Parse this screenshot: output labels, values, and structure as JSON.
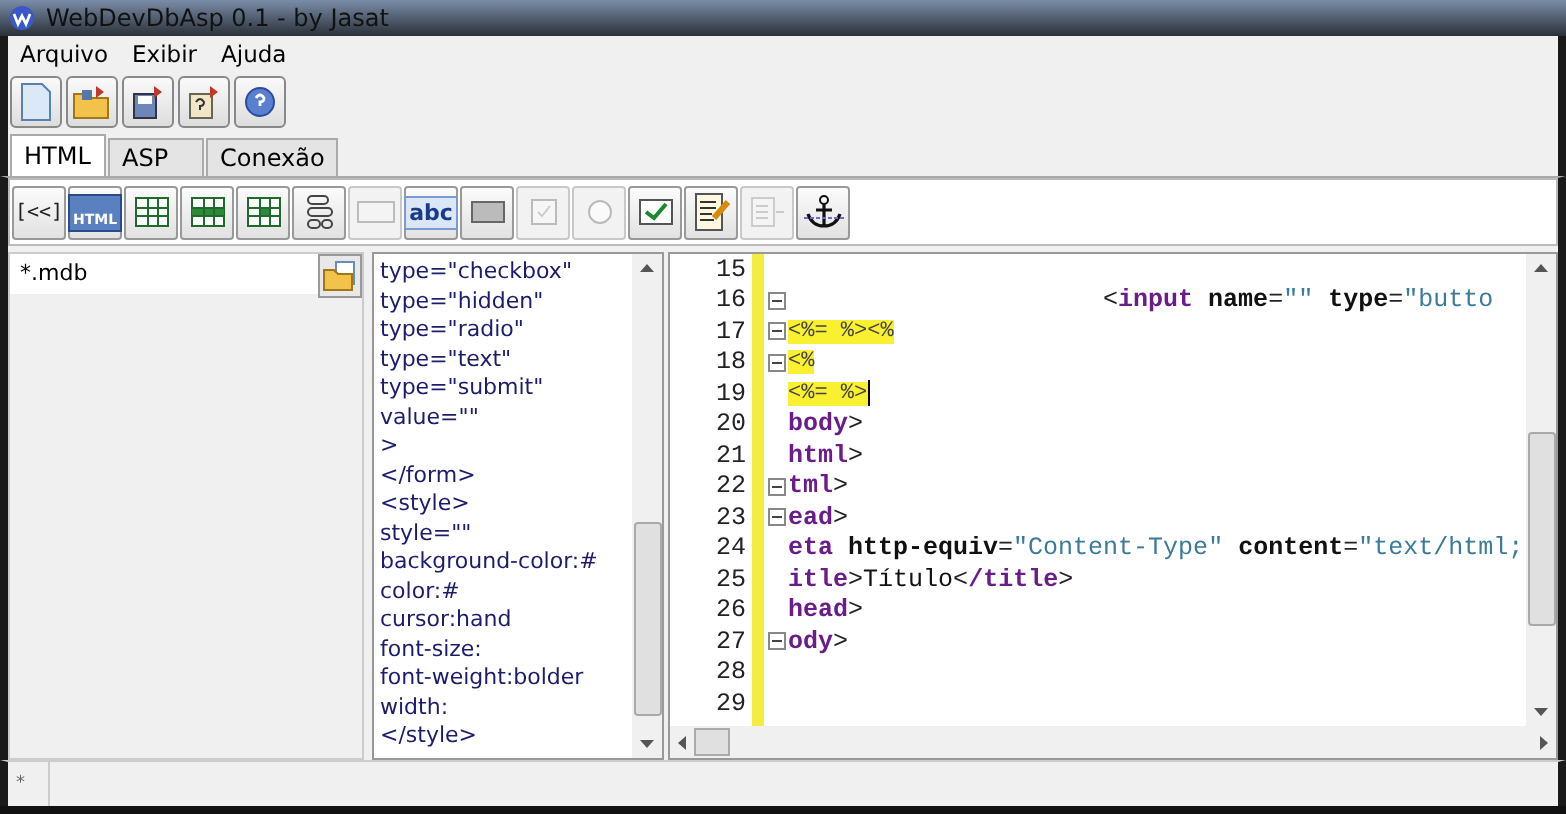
{
  "window": {
    "title": "WebDevDbAsp 0.1 - by Jasat"
  },
  "menu": [
    "Arquivo",
    "Exibir",
    "Ajuda"
  ],
  "toolbar": [
    {
      "kind": "new"
    },
    {
      "kind": "open"
    },
    {
      "kind": "save"
    },
    {
      "kind": "unknown"
    },
    {
      "kind": "help"
    }
  ],
  "tabs": [
    {
      "label": "HTML",
      "selected": true
    },
    {
      "label": "ASP",
      "selected": false
    },
    {
      "label": "Conexão",
      "selected": false
    }
  ],
  "components": [
    {
      "kind": "back",
      "label": "[<<]",
      "disabled": false
    },
    {
      "kind": "html",
      "label": "HTML",
      "disabled": false
    },
    {
      "kind": "table",
      "disabled": false
    },
    {
      "kind": "table-row",
      "disabled": false
    },
    {
      "kind": "table-cell",
      "disabled": false
    },
    {
      "kind": "rows",
      "disabled": false
    },
    {
      "kind": "textbox",
      "disabled": true
    },
    {
      "kind": "label",
      "label": "abc",
      "disabled": false
    },
    {
      "kind": "button",
      "disabled": false
    },
    {
      "kind": "checkbox",
      "disabled": true
    },
    {
      "kind": "radio",
      "disabled": true
    },
    {
      "kind": "check",
      "disabled": false
    },
    {
      "kind": "notepad",
      "disabled": false
    },
    {
      "kind": "list",
      "disabled": true
    },
    {
      "kind": "anchor",
      "disabled": false
    }
  ],
  "database": {
    "value": "*.mdb"
  },
  "snippets": [
    "type=\"checkbox\"",
    "type=\"hidden\"",
    "type=\"radio\"",
    "type=\"text\"",
    "type=\"submit\"",
    "value=\"\"",
    ">",
    "</form>",
    "<style>",
    "style=\"\"",
    "background-color:#",
    "color:#",
    "cursor:hand",
    "font-size:",
    "font-weight:bolder",
    "width:",
    "</style>"
  ],
  "editor": {
    "lines": [
      {
        "number": "15",
        "fold": false,
        "caret": false
      },
      {
        "number": "16",
        "fold": true,
        "caret": false,
        "segments": [
          {
            "kind": "punct",
            "text": "                     <"
          },
          {
            "kind": "tag",
            "text": "input"
          },
          {
            "kind": "attr",
            "text": " name"
          },
          {
            "kind": "punct",
            "text": "="
          },
          {
            "kind": "str",
            "text": "\"\""
          },
          {
            "kind": "attr",
            "text": " type"
          },
          {
            "kind": "punct",
            "text": "="
          },
          {
            "kind": "str",
            "text": "\"butto"
          }
        ]
      },
      {
        "number": "17",
        "fold": true,
        "caret": false,
        "segments": [
          {
            "kind": "asp",
            "text": "<%= %><%"
          }
        ]
      },
      {
        "number": "18",
        "fold": true,
        "caret": false,
        "segments": [
          {
            "kind": "asp",
            "text": "<%"
          }
        ]
      },
      {
        "number": "19",
        "fold": false,
        "caret": true,
        "segments": [
          {
            "kind": "asp",
            "text": "<%= %>"
          }
        ]
      },
      {
        "number": "20",
        "fold": false,
        "caret": false,
        "segments": [
          {
            "kind": "tag",
            "text": "body"
          },
          {
            "kind": "punct",
            "text": ">"
          }
        ]
      },
      {
        "number": "21",
        "fold": false,
        "caret": false,
        "segments": [
          {
            "kind": "tag",
            "text": "html"
          },
          {
            "kind": "punct",
            "text": ">"
          }
        ]
      },
      {
        "number": "22",
        "fold": true,
        "caret": false,
        "segments": [
          {
            "kind": "tag",
            "text": "tml"
          },
          {
            "kind": "punct",
            "text": ">"
          }
        ]
      },
      {
        "number": "23",
        "fold": true,
        "caret": false,
        "segments": [
          {
            "kind": "tag",
            "text": "ead"
          },
          {
            "kind": "punct",
            "text": ">"
          }
        ]
      },
      {
        "number": "24",
        "fold": false,
        "caret": false,
        "segments": [
          {
            "kind": "tag",
            "text": "eta"
          },
          {
            "kind": "attr",
            "text": " http-equiv"
          },
          {
            "kind": "punct",
            "text": "="
          },
          {
            "kind": "str",
            "text": "\"Content-Type\""
          },
          {
            "kind": "attr",
            "text": " content"
          },
          {
            "kind": "punct",
            "text": "="
          },
          {
            "kind": "str",
            "text": "\"text/html;"
          }
        ]
      },
      {
        "number": "25",
        "fold": false,
        "caret": false,
        "segments": [
          {
            "kind": "tag",
            "text": "itle"
          },
          {
            "kind": "punct",
            "text": ">"
          },
          {
            "kind": "plain",
            "text": "Título"
          },
          {
            "kind": "punct",
            "text": "<"
          },
          {
            "kind": "tag",
            "text": "/title"
          },
          {
            "kind": "punct",
            "text": ">"
          }
        ]
      },
      {
        "number": "26",
        "fold": false,
        "caret": false,
        "segments": [
          {
            "kind": "tag",
            "text": "head"
          },
          {
            "kind": "punct",
            "text": ">"
          }
        ]
      },
      {
        "number": "27",
        "fold": true,
        "caret": false,
        "segments": [
          {
            "kind": "tag",
            "text": "ody"
          },
          {
            "kind": "punct",
            "text": ">"
          }
        ]
      },
      {
        "number": "28",
        "fold": false,
        "caret": false
      },
      {
        "number": "29",
        "fold": false,
        "caret": false
      }
    ]
  },
  "status_bar": [
    "*"
  ]
}
